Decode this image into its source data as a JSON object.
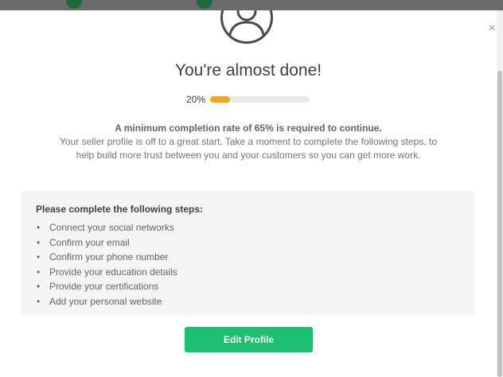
{
  "header": {
    "title": "You're almost done!"
  },
  "progress": {
    "label": "20%",
    "value": 0.2,
    "color": "#f0a818"
  },
  "message": {
    "headline": "A minimum completion rate of 65% is required to continue.",
    "body": "Your seller profile is off to a great start. Take a moment to complete the following steps, to help build more trust between you and your customers so you can get more work."
  },
  "steps": {
    "title": "Please complete the following steps:",
    "items": [
      {
        "label": "Connect your social networks"
      },
      {
        "label": "Confirm your email"
      },
      {
        "label": "Confirm your phone number"
      },
      {
        "label": "Provide your education details"
      },
      {
        "label": "Provide your certifications"
      },
      {
        "label": "Add your personal website"
      }
    ]
  },
  "actions": {
    "edit_profile_label": "Edit Profile",
    "accent_color": "#1dbf73"
  },
  "icons": {
    "close": "close-icon",
    "avatar": "user-avatar-icon"
  }
}
